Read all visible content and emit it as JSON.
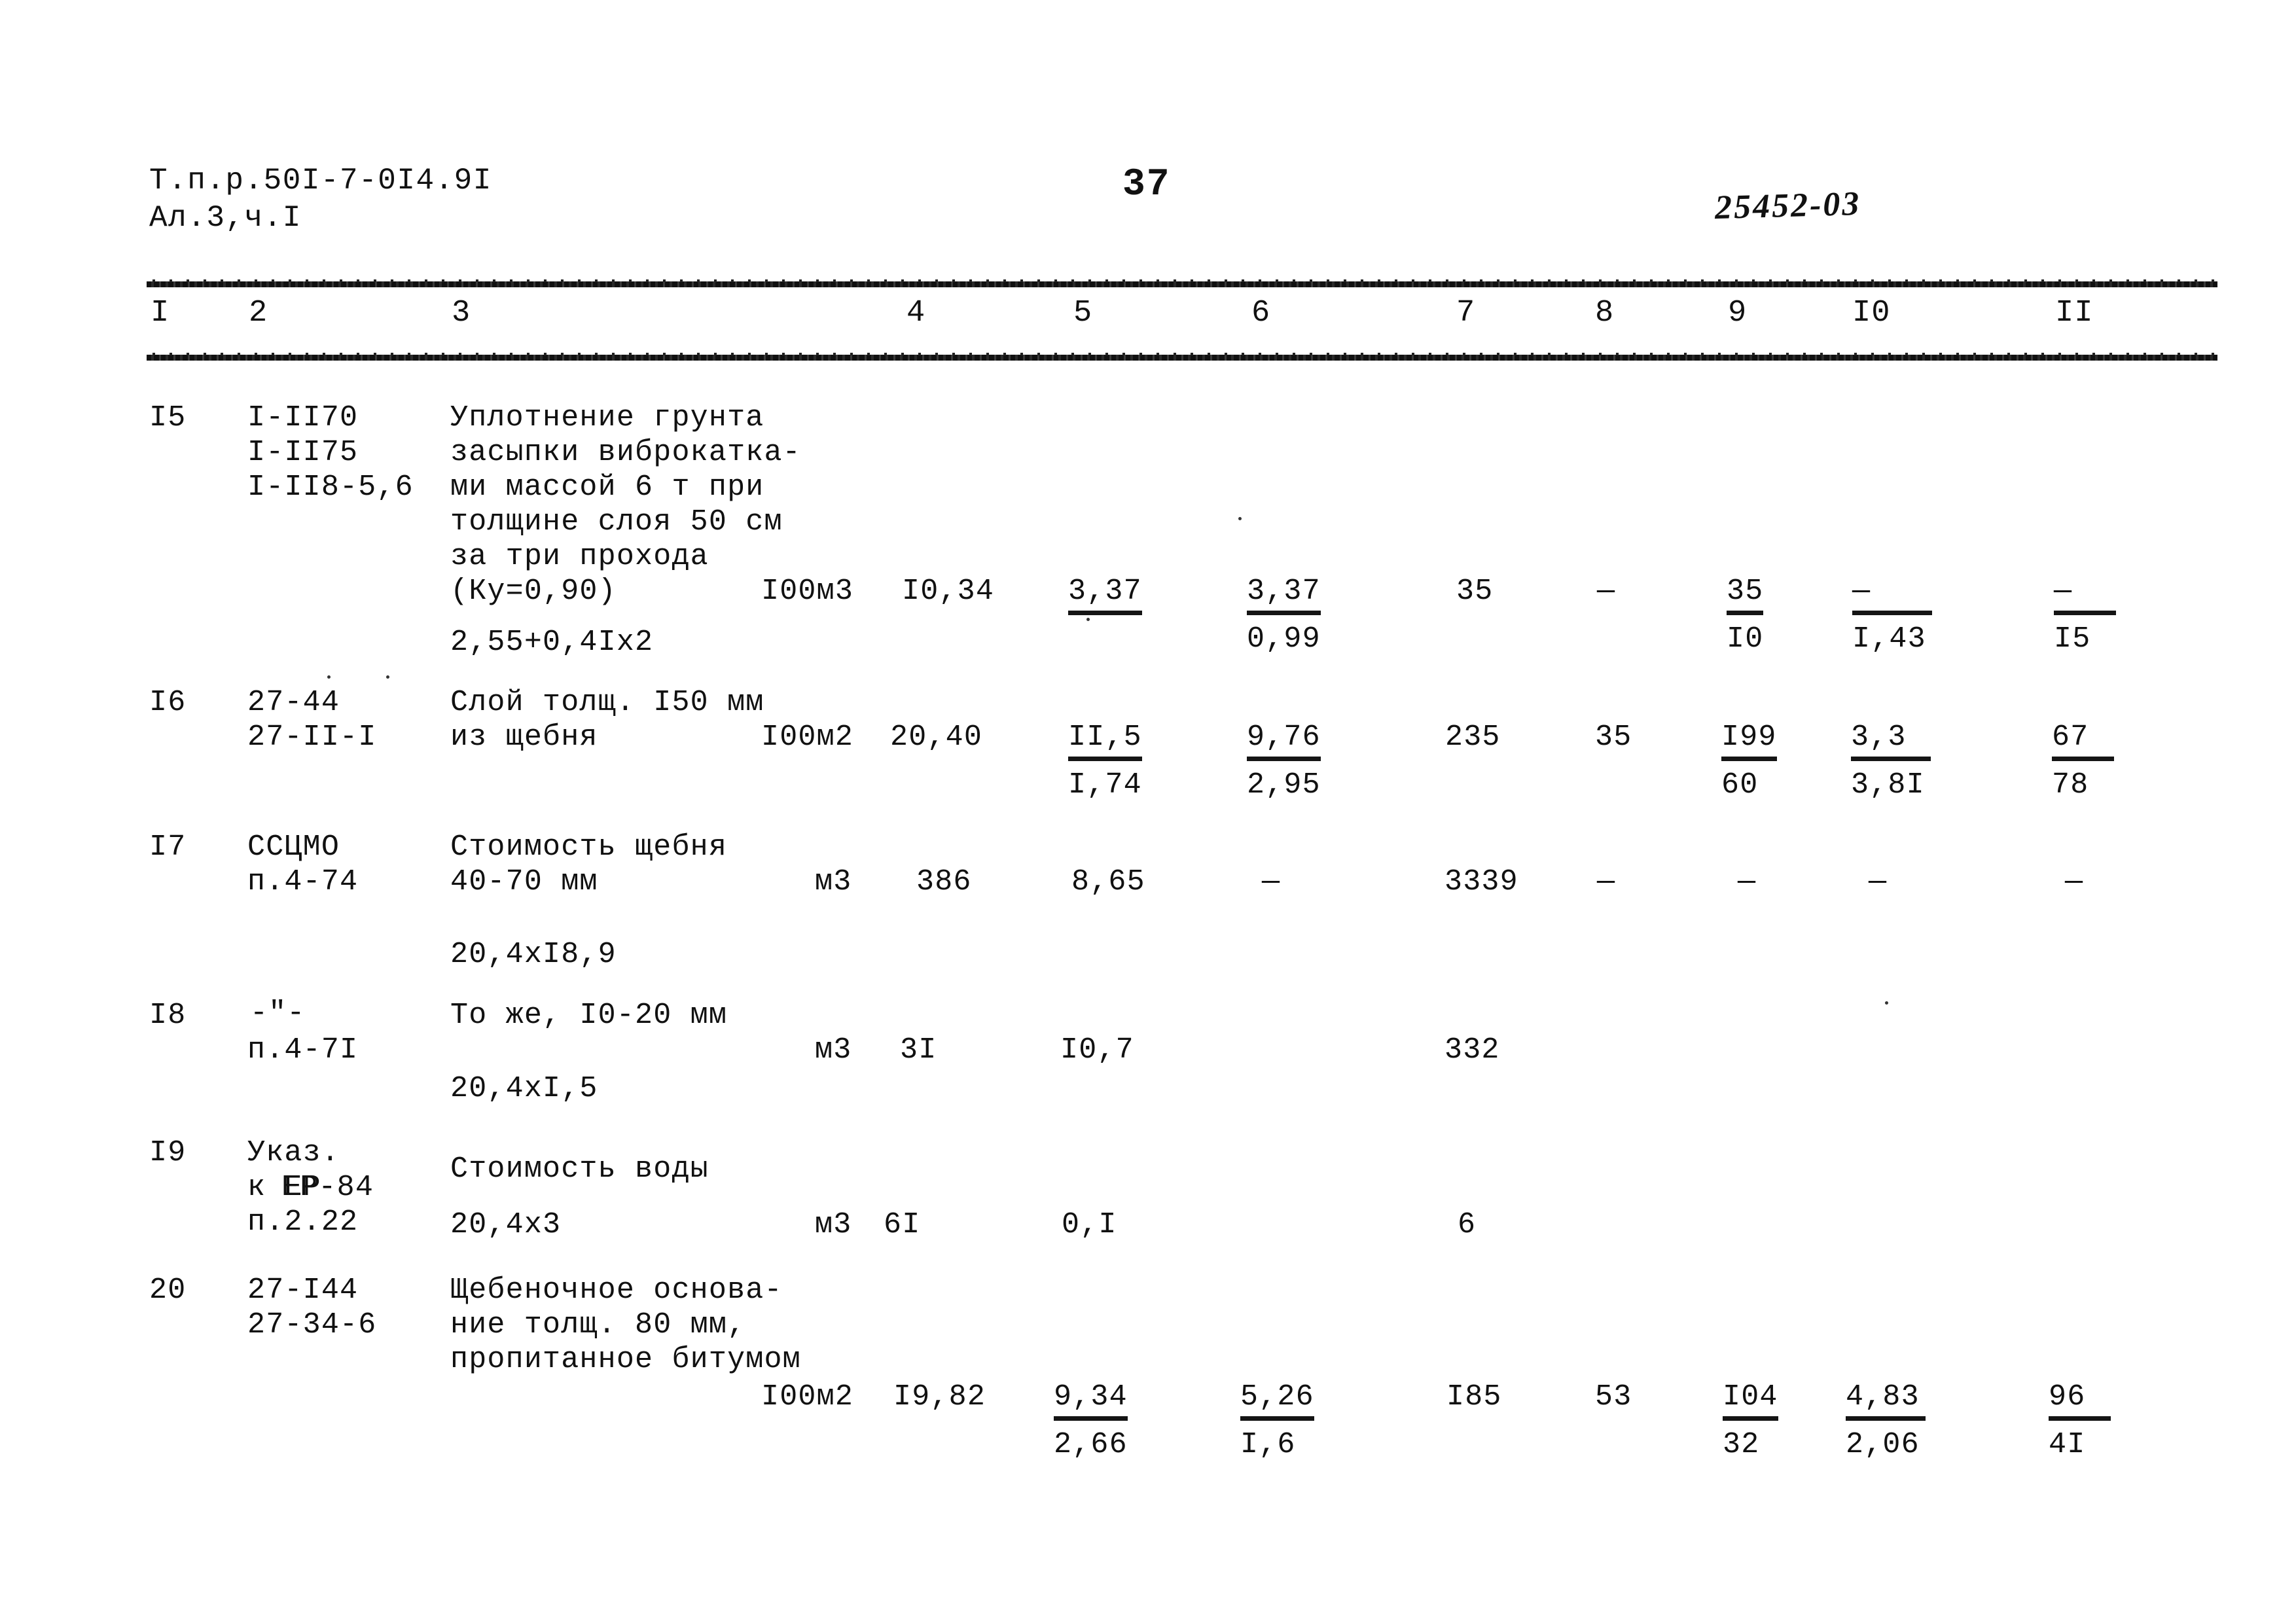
{
  "header": {
    "doc_ref_line1": "Т.п.р.50I-7-0I4.9I",
    "doc_ref_line2": "Ал.3,ч.I",
    "page_number": "37",
    "archive_code": "25452-03"
  },
  "table": {
    "column_headers": [
      "I",
      "2",
      "3",
      "4",
      "5",
      "6",
      "7",
      "8",
      "9",
      "I0",
      "II"
    ],
    "rows": [
      {
        "num": "I5",
        "code_lines": [
          "I-II70",
          "I-II75",
          "I-II8-5,6"
        ],
        "desc_lines": [
          "Уплотнение грунта",
          "засыпки виброкатка-",
          "ми массой 6 т при",
          "толщине слоя 50 см",
          "за три прохода",
          "(Ку=0,90)"
        ],
        "formula": "2,55+0,4Ix2",
        "unit": "I00м3",
        "c4": "I0,34",
        "c5_top": "3,37",
        "c5_bot": "",
        "c6_top": "3,37",
        "c6_bot": "0,99",
        "c7": "35",
        "c8": "—",
        "c9_top": "35",
        "c9_bot": "I0",
        "c10_top": "—",
        "c10_bot": "I,43",
        "c11_top": "—",
        "c11_bot": "I5"
      },
      {
        "num": "I6",
        "code_lines": [
          "27-44",
          "27-II-I"
        ],
        "desc_lines": [
          "Слой толщ. I50 мм",
          "из щебня"
        ],
        "unit": "I00м2",
        "c4": "20,40",
        "c5_top": "II,5",
        "c5_bot": "I,74",
        "c6_top": "9,76",
        "c6_bot": "2,95",
        "c7": "235",
        "c8": "35",
        "c9_top": "I99",
        "c9_bot": "60",
        "c10_top": "3,3",
        "c10_bot": "3,8I",
        "c11_top": "67",
        "c11_bot": "78"
      },
      {
        "num": "I7",
        "code_lines": [
          "ССЦМО",
          "п.4-74"
        ],
        "desc_lines": [
          "Стоимость щебня",
          "40-70 мм"
        ],
        "formula": "20,4xI8,9",
        "unit": "м3",
        "c4": "386",
        "c5": "8,65",
        "c6": "—",
        "c7": "3339",
        "c8": "—",
        "c9": "—",
        "c10": "—",
        "c11": "—"
      },
      {
        "num": "I8",
        "code_lines": [
          "-\"-",
          "п.4-7I"
        ],
        "desc_lines": [
          "То же, I0-20 мм"
        ],
        "formula": "20,4xI,5",
        "unit": "м3",
        "c4": "3I",
        "c5": "I0,7",
        "c7": "332"
      },
      {
        "num": "I9",
        "code_lines": [
          "Указ.",
          "к ЕР",
          "ЕР-84",
          "п.2.22"
        ],
        "desc_lines": [
          "Стоимость воды"
        ],
        "formula": "20,4x3",
        "unit": "м3",
        "c4": "6I",
        "c5": "0,I",
        "c7": "6"
      },
      {
        "num": "20",
        "code_lines": [
          "27-I44",
          "27-34-6"
        ],
        "desc_lines": [
          "Щебеночное основа-",
          "ние толщ. 80 мм,",
          "пропитанное битумом"
        ],
        "unit": "I00м2",
        "c4": "I9,82",
        "c5_top": "9,34",
        "c5_bot": "2,66",
        "c6_top": "5,26",
        "c6_bot": "I,6",
        "c7": "I85",
        "c8": "53",
        "c9_top": "I04",
        "c9_bot": "32",
        "c10_top": "4,83",
        "c10_bot": "2,06",
        "c11_top": "96",
        "c11_bot": "4I"
      }
    ]
  }
}
